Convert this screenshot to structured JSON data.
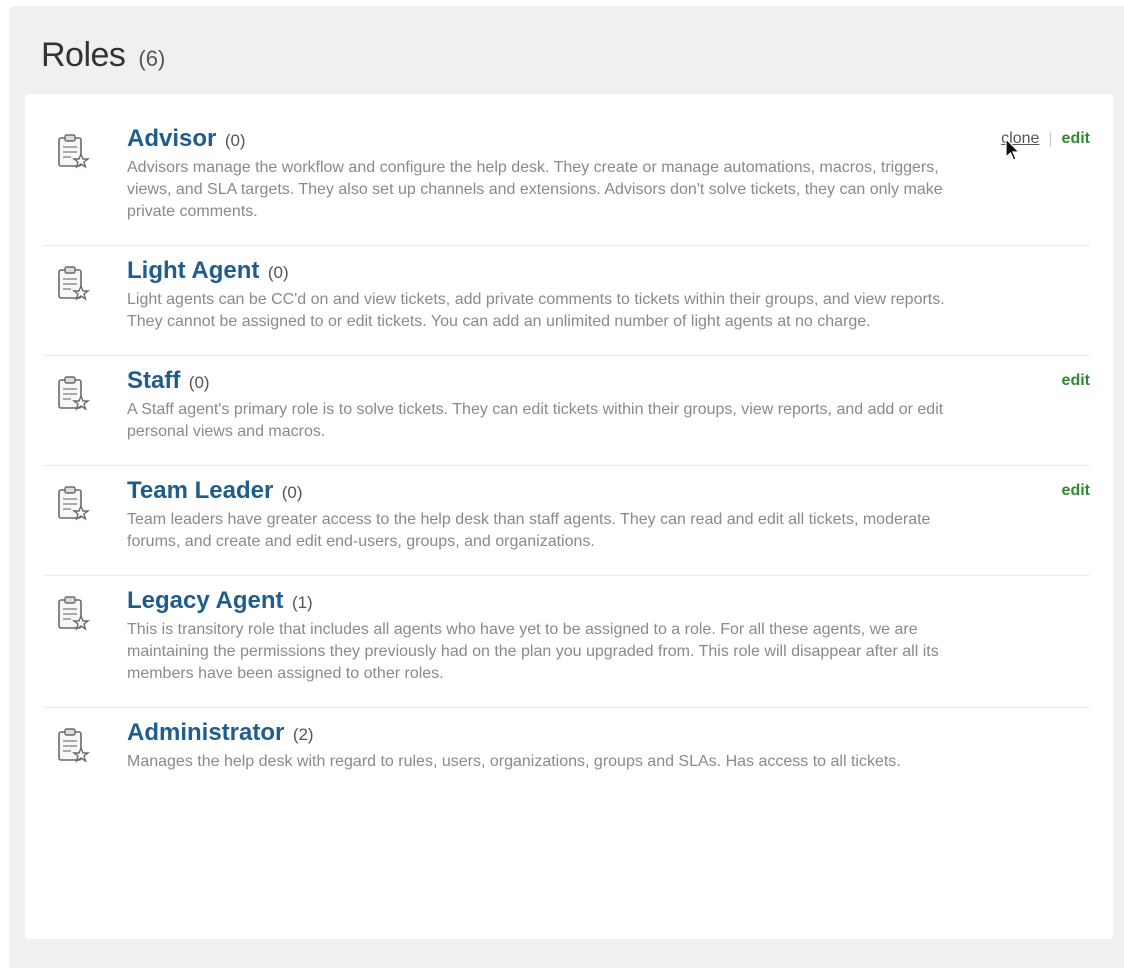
{
  "header": {
    "title": "Roles",
    "count": "(6)"
  },
  "actions": {
    "clone_label": "clone",
    "separator": "|",
    "edit_label": "edit"
  },
  "roles": [
    {
      "name": "Advisor",
      "count": "(0)",
      "description": "Advisors manage the workflow and configure the help desk. They create or manage automations, macros, triggers, views, and SLA targets. They also set up channels and extensions. Advisors don't solve tickets, they can only make private comments."
    },
    {
      "name": "Light Agent",
      "count": "(0)",
      "description": "Light agents can be CC'd on and view tickets, add private comments to tickets within their groups, and view reports. They cannot be assigned to or edit tickets. You can add an unlimited number of light agents at no charge."
    },
    {
      "name": "Staff",
      "count": "(0)",
      "description": "A Staff agent's primary role is to solve tickets. They can edit tickets within their groups, view reports, and add or edit personal views and macros."
    },
    {
      "name": "Team Leader",
      "count": "(0)",
      "description": "Team leaders have greater access to the help desk than staff agents. They can read and edit all tickets, moderate forums, and create and edit end-users, groups, and organizations."
    },
    {
      "name": "Legacy Agent",
      "count": "(1)",
      "description": "This is transitory role that includes all agents who have yet to be assigned to a role. For all these agents, we are maintaining the permissions they previously had on the plan you upgraded from. This role will disappear after all its members have been assigned to other roles."
    },
    {
      "name": "Administrator",
      "count": "(2)",
      "description": "Manages the help desk with regard to rules, users, organizations, groups and SLAs. Has access to all tickets."
    }
  ],
  "icons": {
    "role_icon": "clipboard-star-icon",
    "cursor": "mouse-pointer-icon"
  },
  "colors": {
    "role_name": "#1f5d8e",
    "edit_link": "#2e8b2e",
    "description": "#8a8a8a"
  }
}
